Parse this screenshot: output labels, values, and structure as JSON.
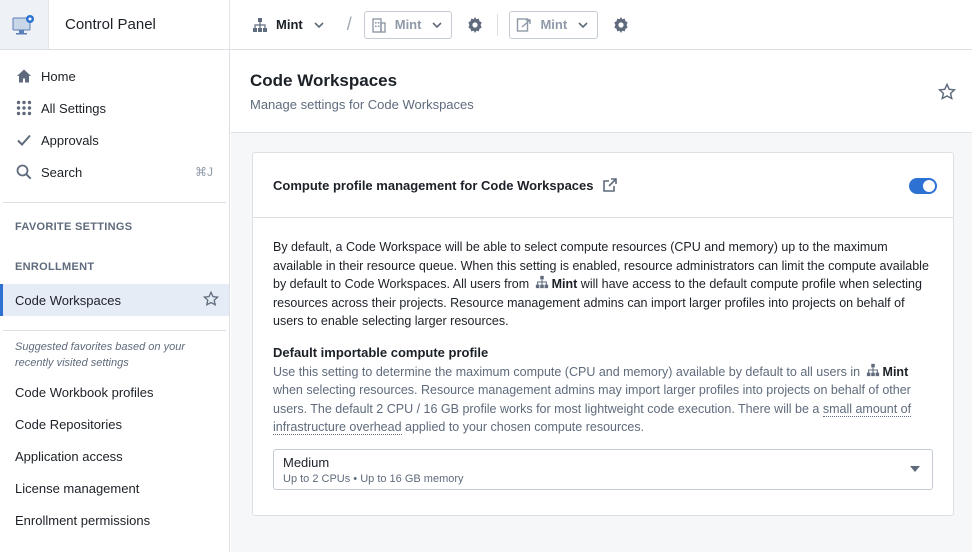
{
  "app": {
    "title": "Control Panel"
  },
  "breadcrumbs": {
    "org": "Mint",
    "enrollment": "Mint",
    "space": "Mint"
  },
  "sidebar": {
    "nav": [
      {
        "label": "Home",
        "icon": "home-icon"
      },
      {
        "label": "All Settings",
        "icon": "grid-icon"
      },
      {
        "label": "Approvals",
        "icon": "check-icon"
      },
      {
        "label": "Search",
        "icon": "search-icon",
        "shortcut": "⌘J"
      }
    ],
    "favorite_heading": "FAVORITE SETTINGS",
    "enrollment_heading": "ENROLLMENT",
    "active_item": "Code Workspaces",
    "suggest_text_1": "Suggested favorites based on your",
    "suggest_text_2": "recently visited settings",
    "suggested": [
      "Code Workbook profiles",
      "Code Repositories",
      "Application access",
      "License management",
      "Enrollment permissions"
    ]
  },
  "page": {
    "title": "Code Workspaces",
    "subtitle": "Manage settings for Code Workspaces"
  },
  "card": {
    "title": "Compute profile management for Code Workspaces",
    "toggle_on": true,
    "desc_1": "By default, a Code Workspace will be able to select compute resources (CPU and memory) up to the maximum available in their resource queue. When this setting is enabled, resource administrators can limit the compute available by default to Code Workspaces. All users from",
    "desc_org": "Mint",
    "desc_2": "will have access to the default compute profile when selecting resources across their projects. Resource management admins can import larger profiles into projects on behalf of users to enable selecting larger resources.",
    "field_label": "Default importable compute profile",
    "field_desc_1": "Use this setting to determine the maximum compute (CPU and memory) available by default to all users in",
    "field_desc_org": "Mint",
    "field_desc_2": "when selecting resources. Resource management admins may import larger profiles into projects on behalf of other users. The default 2 CPU / 16 GB profile works for most lightweight code execution. There will be a",
    "field_desc_link": "small amount of infrastructure overhead",
    "field_desc_3": "applied to your chosen compute resources.",
    "select_value": "Medium",
    "select_hint": "Up to 2 CPUs • Up to 16 GB memory"
  },
  "colors": {
    "accent": "#2d72d2",
    "active_bg": "#e6ecf5",
    "border": "#dce0e5"
  }
}
